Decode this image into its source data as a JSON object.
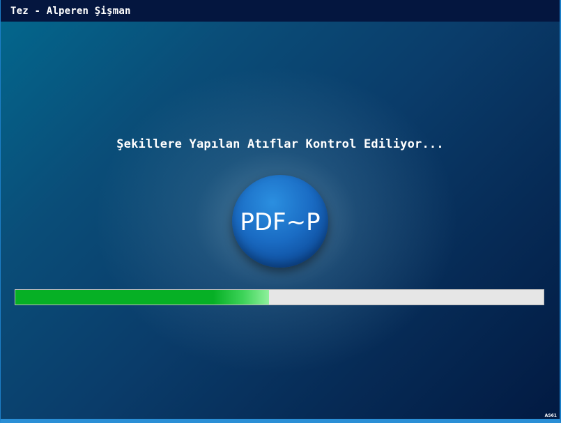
{
  "window": {
    "title": "Tez - Alperen Şişman"
  },
  "main": {
    "status_message": "Şekillere Yapılan Atıflar Kontrol Ediliyor...",
    "logo_text": "PDF~P",
    "progress": {
      "fraction": 0.48,
      "fill_color": "#06b025",
      "track_color": "#e6e6e6"
    },
    "corner_badge": "AS61"
  },
  "colors": {
    "titlebar_bg": "#04163f",
    "window_border": "#1d7fc8",
    "logo_blue": "#1a6cc4"
  }
}
